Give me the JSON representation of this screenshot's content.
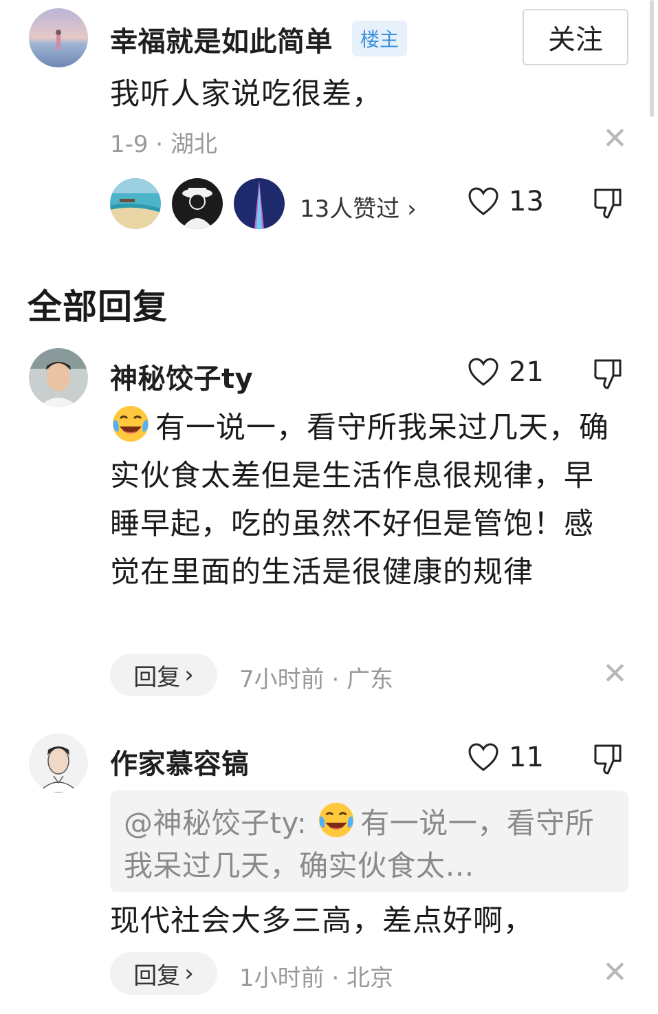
{
  "post": {
    "author": "幸福就是如此简单",
    "badge": "楼主",
    "follow_label": "关注",
    "text": "我听人家说吃很差，",
    "meta": "1-9 · 湖北",
    "likers_label": "13人赞过 ›",
    "like_count": "13"
  },
  "section_title": "全部回复",
  "replies": [
    {
      "author": "神秘饺子ty",
      "like_count": "21",
      "text": "有一说一，看守所我呆过几天，确实伙食太差但是生活作息很规律，早睡早起，吃的虽然不好但是管饱！感觉在里面的生活是很健康的规律",
      "reply_label": "回复",
      "meta": "7小时前 · 广东"
    },
    {
      "author": "作家慕容镐",
      "like_count": "11",
      "quote_author": "@神秘饺子ty:",
      "quote_text": "有一说一，看守所我呆过几天，确实伙食太…",
      "text": "现代社会大多三高，差点好啊，",
      "reply_label": "回复",
      "meta": "1小时前 · 北京"
    }
  ],
  "icons": {
    "heart": "heart-outline-icon",
    "dislike": "thumbs-down-icon",
    "close": "close-icon",
    "emoji": "laughing-crying-emoji"
  },
  "colors": {
    "badge_text": "#3b8fd9",
    "badge_bg": "#e6f1fc",
    "meta_text": "#999999"
  }
}
